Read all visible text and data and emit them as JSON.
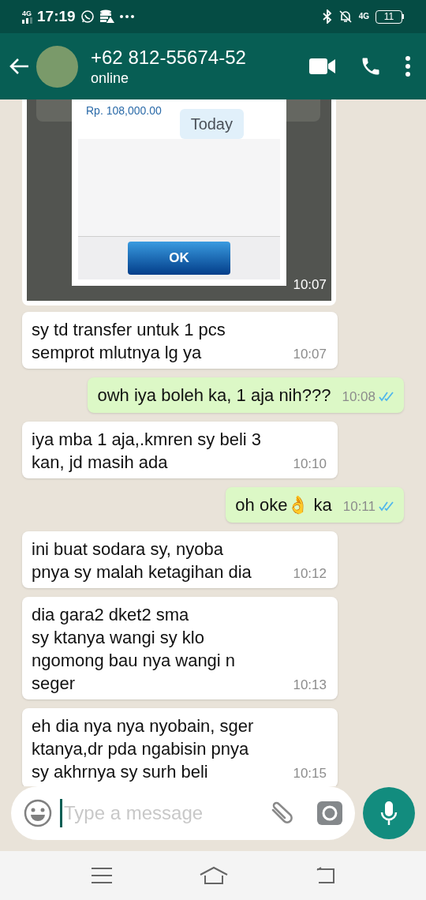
{
  "status_bar": {
    "network": "4G",
    "time": "17:19",
    "network_right": "4G",
    "battery": "11"
  },
  "header": {
    "title": "+62 812-55674-52",
    "subtitle": "online"
  },
  "image_message": {
    "amount": "Rp. 108,000.00",
    "date_chip": "Today",
    "button": "OK",
    "time": "10:07"
  },
  "messages": [
    {
      "kind": "incoming",
      "text": "sy td transfer untuk 1 pcs\nsemprot mlutnya lg ya",
      "time": "10:07"
    },
    {
      "kind": "outgoing",
      "text": "owh iya boleh ka, 1 aja nih???",
      "time": "10:08",
      "read": true
    },
    {
      "kind": "incoming",
      "text": "iya mba 1 aja,.kmren sy beli 3\nkan, jd masih ada",
      "time": "10:10"
    },
    {
      "kind": "outgoing",
      "text": "oh  oke👌 ka",
      "time": "10:11",
      "read": true
    },
    {
      "kind": "incoming",
      "text": "ini buat sodara sy, nyoba\npnya sy malah ketagihan dia",
      "time": "10:12"
    },
    {
      "kind": "incoming",
      "text": "dia gara2 dket2 sma\nsy ktanya wangi sy klo\nngomong bau nya wangi n\nseger",
      "time": "10:13"
    },
    {
      "kind": "incoming",
      "text": "eh dia nya nya nyobain, sger\nktanya,dr pda ngabisin pnya\nsy akhrnya sy surh beli",
      "time": "10:15"
    }
  ],
  "composer": {
    "placeholder": "Type a message"
  }
}
